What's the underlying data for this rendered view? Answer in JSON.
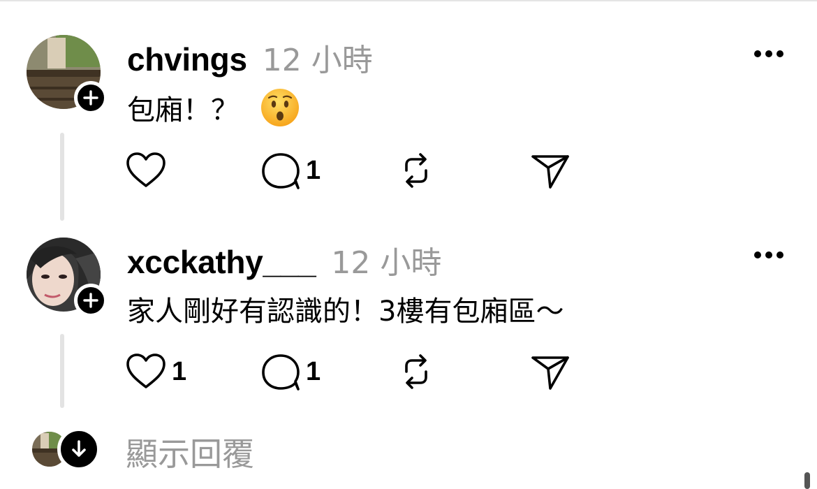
{
  "comments": [
    {
      "username": "chvings",
      "time": "12 小時",
      "text": "包廂！？",
      "emoji": "hushed-face",
      "like_count": "",
      "reply_count": "1"
    },
    {
      "username": "xcckathy___",
      "time": "12 小時",
      "text": "家人剛好有認識的！3樓有包廂區～",
      "emoji": "",
      "like_count": "1",
      "reply_count": "1"
    }
  ],
  "show_replies_label": "顯示回覆",
  "icons": [
    "plus-icon",
    "more-icon",
    "heart-icon",
    "comment-icon",
    "repost-icon",
    "share-icon",
    "arrow-down-icon"
  ],
  "colors": {
    "text": "#000000",
    "muted": "#999999",
    "thread_line": "#e3e3e3"
  }
}
